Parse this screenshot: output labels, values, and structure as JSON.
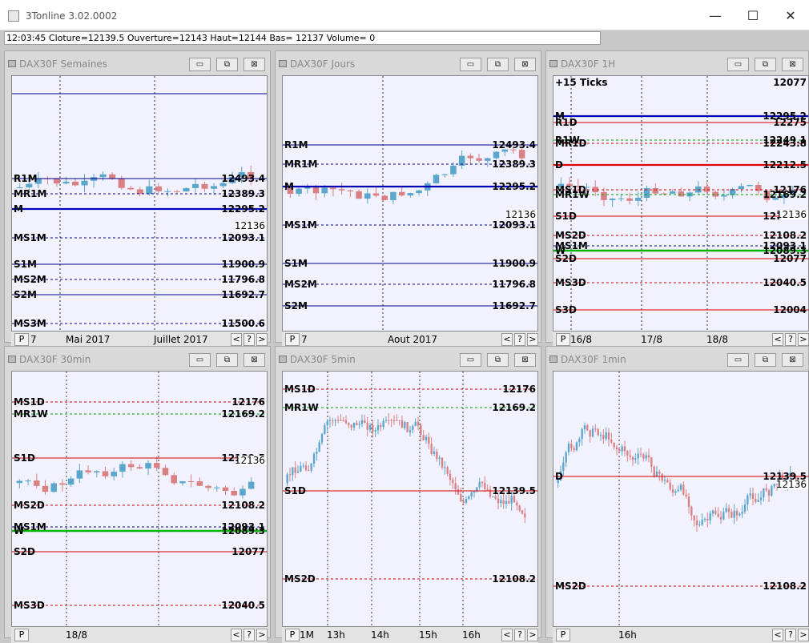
{
  "app": {
    "title": "3Tonline 3.02.0002",
    "minimize": "—",
    "maximize": "☐",
    "close": "✕"
  },
  "infobar": {
    "text": "12:03:45   Cloture=12139.5  Ouverture=12143  Haut=12144  Bas= 12137  Volume= 0"
  },
  "controls": {
    "minimize": "▭",
    "restore": "⧉",
    "close": "⊠",
    "p": "P",
    "prev": "<",
    "help": "?",
    "next": ">"
  },
  "colors": {
    "up": "#5aa6cc",
    "down": "#d98083",
    "thick_blue": "#0000b4",
    "green": "#00b400",
    "red": "#e00000"
  },
  "panels": [
    {
      "title": "DAX30F Semaines",
      "timeLabels": [
        "7",
        "Mai 2017",
        "Juillet 2017"
      ],
      "tag": "12136",
      "levels": [
        [
          "",
          "",
          ""
        ],
        [
          "R1M",
          "12493.4",
          "solid"
        ],
        [
          "MR1M",
          "12389.3",
          "dashed"
        ],
        [
          "M",
          "12295.2",
          "thick"
        ],
        [
          "MS1M",
          "12093.1",
          "dashed"
        ],
        [
          "S1M",
          "11900.9",
          "solid"
        ],
        [
          "MS2M",
          "11796.8",
          "dashed"
        ],
        [
          "S2M",
          "11692.7",
          "solid"
        ],
        [
          "MS3M",
          "11500.6",
          "dashed"
        ]
      ]
    },
    {
      "title": "DAX30F Jours",
      "timeLabels": [
        "7",
        "Aout 2017"
      ],
      "tag": "12136",
      "levels": [
        [
          "R1M",
          "12493.4",
          "solid"
        ],
        [
          "MR1M",
          "12389.3",
          "dashed"
        ],
        [
          "M",
          "12295.2",
          "thick"
        ],
        [
          "MS1M",
          "12093.1",
          "dashed"
        ],
        [
          "S1M",
          "11900.9",
          "solid"
        ],
        [
          "MS2M",
          "11796.8",
          "dashed"
        ],
        [
          "S2M",
          "11692.7",
          "solid"
        ]
      ]
    },
    {
      "title": "DAX30F 1H",
      "ticks": "+15 Ticks",
      "tickValue": "12077",
      "timeLabels": [
        "16/8",
        "17/8",
        "18/8"
      ],
      "tag": "12136",
      "levels": [
        [
          "M",
          "12295.2",
          "thick"
        ],
        [
          "R1D",
          "12275",
          "red"
        ],
        [
          "R1W",
          "12249.1",
          "green"
        ],
        [
          "MR1D",
          "12243.8",
          "dashed-red"
        ],
        [
          "D",
          "12212.5",
          "thick-red"
        ],
        [
          "MS1D",
          "12176",
          "dashed-red"
        ],
        [
          "MR1W",
          "12169.2",
          "green"
        ],
        [
          "S1D",
          "12139.5",
          "red"
        ],
        [
          "MS2D",
          "12108.2",
          "dashed-red"
        ],
        [
          "MS1M",
          "12093.1",
          "dashed"
        ],
        [
          "W",
          "12089.3",
          "thick-green"
        ],
        [
          "S2D",
          "12077",
          "red"
        ],
        [
          "MS3D",
          "12040.5",
          "dashed-red"
        ],
        [
          "S3D",
          "12004",
          "red"
        ]
      ]
    },
    {
      "title": "DAX30F 30min",
      "timeLabels": [
        "18/8"
      ],
      "tag": "12136",
      "levels": [
        [
          "MS1D",
          "12176",
          "dashed-red"
        ],
        [
          "MR1W",
          "12169.2",
          "green"
        ],
        [
          "S1D",
          "12139.5",
          "red"
        ],
        [
          "MS2D",
          "12108.2",
          "dashed-red"
        ],
        [
          "MS1M",
          "12093.1",
          "dashed"
        ],
        [
          "W",
          "12089.3",
          "thick-green"
        ],
        [
          "S2D",
          "12077",
          "red"
        ],
        [
          "MS3D",
          "12040.5",
          "dashed-red"
        ]
      ]
    },
    {
      "title": "DAX30F 5min",
      "timeLabels": [
        "1M",
        "13h",
        "14h",
        "15h",
        "16h"
      ],
      "levels": [
        [
          "MS1D",
          "12176",
          "dashed-red"
        ],
        [
          "MR1W",
          "12169.2",
          "green"
        ],
        [
          "S1D",
          "12139.5",
          "red"
        ],
        [
          "MS2D",
          "12108.2",
          "dashed-red"
        ]
      ]
    },
    {
      "title": "DAX30F 1min",
      "timeLabels": [
        "16h"
      ],
      "tag": "12136",
      "levels": [
        [
          "D",
          "12139.5",
          "red"
        ],
        [
          "MS2D",
          "12108.2",
          "dashed-red"
        ]
      ]
    }
  ]
}
